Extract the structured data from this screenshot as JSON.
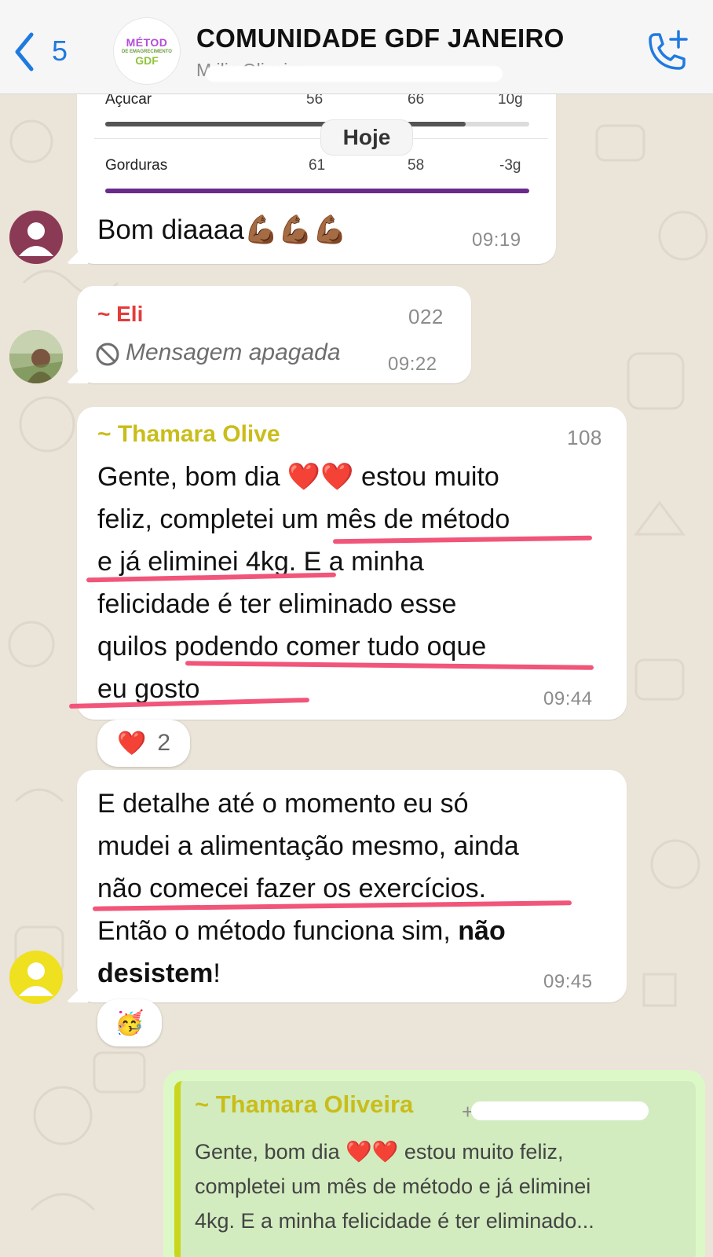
{
  "header": {
    "back_count": "5",
    "group_title": "COMUNIDADE GDF JANEIRO",
    "group_subtitle": "M                                    ilis Oliveira...",
    "logo": {
      "line1": "MÉTOD",
      "line2": "DE EMAGRECIMENTO",
      "line3": "GDF"
    }
  },
  "date_separator": "Hoje",
  "nutrition_card": {
    "rows": [
      {
        "label": "Açucar",
        "v1": "56",
        "v2": "66",
        "v3": "10g",
        "bar_color": "#555555",
        "bar_fill": 0.85
      },
      {
        "label": "Gorduras",
        "v1": "61",
        "v2": "58",
        "v3": "-3g",
        "bar_color": "#6a2a8c",
        "bar_fill": 1.0
      }
    ]
  },
  "messages": [
    {
      "text": "Bom diaaaa💪🏾💪🏾💪🏾",
      "time": "09:19"
    },
    {
      "sender": "~ Eli",
      "sender_tail": "022",
      "deleted_text": "Mensagem apagada",
      "time": "09:22"
    },
    {
      "sender": "~ Thamara Olive",
      "sender_tail": "108",
      "lines": [
        "Gente, bom dia ❤️❤️ estou muito",
        "feliz, completei um mês de método",
        "e já eliminei 4kg. E a minha",
        "felicidade é ter eliminado esse",
        "quilos podendo comer tudo oque",
        "eu gosto"
      ],
      "time": "09:44",
      "reaction": {
        "emoji": "❤️",
        "count": "2"
      }
    },
    {
      "lines": [
        "E detalhe até o momento eu só",
        "mudei a alimentação mesmo, ainda",
        "não comecei fazer os exercícios."
      ],
      "line4_normal": "Então o método funciona sim, ",
      "line4_bold": "não",
      "line5_bold": "desistem",
      "line5_normal": "!",
      "time": "09:45",
      "reaction": {
        "emoji": "🥳"
      }
    }
  ],
  "reply": {
    "sender": "~ Thamara Oliveira",
    "sender_tail": "+55            08",
    "lines": [
      "Gente, bom dia ❤️❤️ estou muito feliz,",
      "completei um mês de método e já eliminei",
      "4kg. E a minha felicidade é ter eliminado..."
    ]
  },
  "colors": {
    "accent_blue": "#1f7ae0",
    "underline_pink": "#f1557a",
    "outgoing_green": "#dcf8c6",
    "sender_yellow": "#c9bd1a",
    "sender_red": "#e43b3b"
  }
}
